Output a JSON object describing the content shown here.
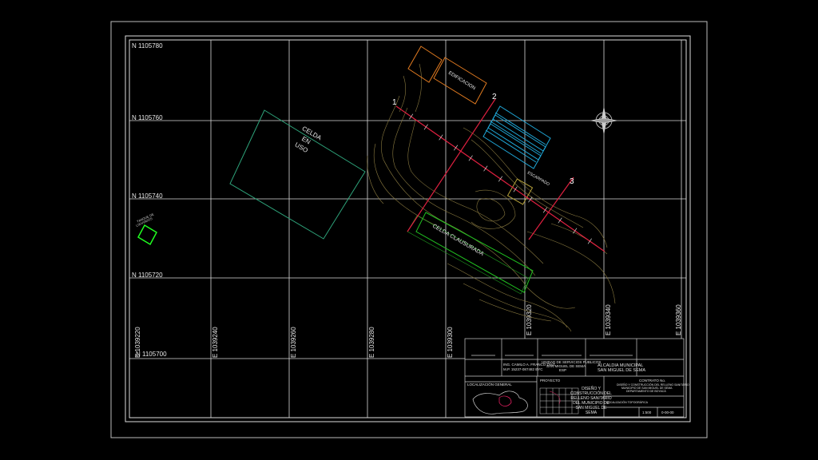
{
  "drawing": {
    "north_labels": [
      "N 1105780",
      "N 1105760",
      "N 1105740",
      "N 1105720",
      "N 1105700"
    ],
    "east_labels": [
      "E 1039220",
      "E 1039240",
      "E 1039260",
      "E 1039280",
      "E 1039300",
      "E 1039320",
      "E 1039340",
      "E 1039360"
    ],
    "celda_en_uso": [
      "CELDA",
      "EN",
      "USO"
    ],
    "celda_clausurada": "CELDA CLAUSURADA",
    "edificacion": "EDIFICACION",
    "escarpado": "ESCARPADO",
    "section_markers": [
      "1",
      "2",
      "3"
    ],
    "small_box_label": [
      "TANQUE DE",
      "LIXIVIADOS"
    ]
  },
  "colors": {
    "background": "#000000",
    "grid": "#d8d8d8",
    "section_line": "#e02040",
    "celda_uso": "#2ea37a",
    "celda_clausurada": "#20c020",
    "edificacion": "#e07a20",
    "panels": "#1fa6d6",
    "small_box": "#20ff20",
    "contour": "#8a7a40"
  },
  "title_block": {
    "org_left_1": "ING. CAMILO A. FRANCO DÍAZ",
    "org_left_2": "M.P. 15237-087482 BYC",
    "org_mid_1": "UNIDAD DE SERVICIOS PUBLICOS",
    "org_mid_2": "SAN MIGUEL DE SEMA",
    "org_mid_3": "ESP",
    "org_right_1": "ALCALDIA MUNICIPAL",
    "org_right_2": "SAN MIGUEL DE SEMA",
    "localizacion": "LOCALIZACIÓN GENERAL",
    "proyecto": "PROYECTO",
    "project_desc": [
      "DISEÑO Y",
      "CONSTRUCCIÓN DEL",
      "RELLENO SANITARIO",
      "DEL MUNICIPIO DE",
      "SAN MIGUEL DE",
      "SEMA"
    ],
    "contract_1": "CONTRATO No.",
    "contract_2": "DISEÑO Y CONSTRUCCIÓN DEL RELLENO SANITARIO",
    "contract_3": "MUNICIPIO DE SAN MIGUEL DE SEMA",
    "contract_4": "DEPARTAMENTO DE BOYACÁ",
    "plano": "LOCALIZACIÓN TOPOGRÁFICA",
    "escala": "1:500",
    "fecha": "0-00-00"
  }
}
